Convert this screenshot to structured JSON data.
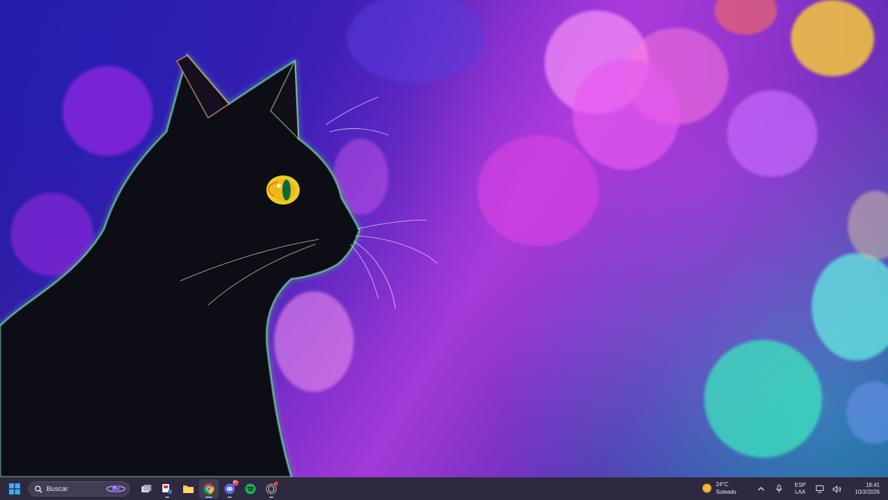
{
  "taskbar": {
    "search": {
      "placeholder": "Buscar"
    },
    "apps": [
      {
        "name": "task-view",
        "icon": "task-view-icon"
      },
      {
        "name": "snipping-tool",
        "icon": "snip-icon"
      },
      {
        "name": "file-explorer",
        "icon": "folder-icon"
      },
      {
        "name": "chrome",
        "icon": "chrome-icon",
        "active": true
      },
      {
        "name": "discord",
        "icon": "discord-icon",
        "badge": "9+"
      },
      {
        "name": "spotify",
        "icon": "spotify-icon"
      },
      {
        "name": "chatgpt",
        "icon": "chatgpt-icon"
      }
    ],
    "weather": {
      "temperature": "24°C",
      "condition": "Soleado"
    },
    "tray": {
      "lang_primary": "ESP",
      "lang_secondary": "LAA",
      "time": "18:41",
      "date": "10/3/2026"
    }
  },
  "colors": {
    "taskbar_bg": "#1c1630",
    "accent_blue": "#7fb3ff",
    "badge_red": "#d6435a"
  }
}
